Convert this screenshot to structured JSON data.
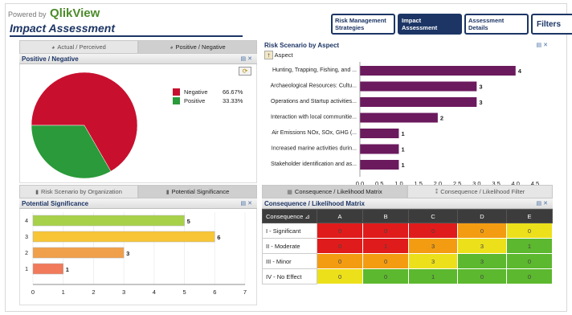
{
  "header": {
    "powered_by": "Powered by",
    "brand": "QlikView",
    "title": "Impact Assessment"
  },
  "nav": {
    "tabs": [
      {
        "label": "Risk Management Strategies"
      },
      {
        "label": "Impact Assessment"
      },
      {
        "label": "Assessment Details"
      }
    ],
    "filters_label": "Filters"
  },
  "colors": {
    "navy": "#1c3565",
    "negative": "#c8102e",
    "positive": "#2a9a3a",
    "bar_purple": "#6b1a5e",
    "cell_red": "#e01b1b",
    "cell_orange": "#f39c12",
    "cell_yellow": "#ece01b",
    "cell_green": "#5cb82e"
  },
  "left_top": {
    "tabs": [
      {
        "label": "Actual / Perceived",
        "icon": "pie-icon"
      },
      {
        "label": "Positive / Negative",
        "icon": "pie-icon"
      }
    ],
    "caption": "Positive / Negative",
    "legend": [
      {
        "label": "Negative",
        "value": "66.67%"
      },
      {
        "label": "Positive",
        "value": "33.33%"
      }
    ]
  },
  "right_top": {
    "caption": "Risk Scenario by Aspect",
    "dim_label": "Aspect"
  },
  "left_bottom": {
    "tabs": [
      {
        "label": "Risk Scenario by Organization"
      },
      {
        "label": "Potential Significance"
      }
    ],
    "caption": "Potential Significance"
  },
  "right_bottom": {
    "tabs": [
      {
        "label": "Consequence / Likelihood Matrix"
      },
      {
        "label": "Consequence / Likelihood Filter"
      }
    ],
    "caption": "Consequence / Likelihood Matrix",
    "header": {
      "label": "Consequence",
      "columns": [
        "A",
        "B",
        "C",
        "D",
        "E"
      ]
    },
    "rows": [
      {
        "label": "I - Significant",
        "values": [
          "0",
          "0",
          "0",
          "0",
          "0"
        ],
        "colors": [
          "red",
          "red",
          "red",
          "orange",
          "yellow"
        ]
      },
      {
        "label": "II - Moderate",
        "values": [
          "0",
          "1",
          "3",
          "3",
          "1"
        ],
        "colors": [
          "red",
          "red",
          "orange",
          "yellow",
          "green"
        ]
      },
      {
        "label": "III - Minor",
        "values": [
          "0",
          "0",
          "3",
          "3",
          "0"
        ],
        "colors": [
          "orange",
          "orange",
          "yellow",
          "green",
          "green"
        ]
      },
      {
        "label": "IV - No Effect",
        "values": [
          "0",
          "0",
          "1",
          "0",
          "0"
        ],
        "colors": [
          "yellow",
          "green",
          "green",
          "green",
          "green"
        ]
      }
    ]
  },
  "chart_data": [
    {
      "type": "pie",
      "title": "Positive / Negative",
      "slices": [
        {
          "label": "Negative",
          "value": 66.67
        },
        {
          "label": "Positive",
          "value": 33.33
        }
      ]
    },
    {
      "type": "bar",
      "orientation": "horizontal",
      "title": "Risk Scenario by Aspect",
      "categories": [
        "Hunting, Trapping, Fishing, and ...",
        "Archaeological Resources: Cultu...",
        "Operations and Startup activities...",
        "Interaction with local communitie...",
        "Air Emissions NOx, SOx, GHG (...",
        "Increased marine activities durin...",
        "Stakeholder identification and as..."
      ],
      "values": [
        4,
        3,
        3,
        2,
        1,
        1,
        1
      ],
      "xticks": [
        "0.0",
        "0.5",
        "1.0",
        "1.5",
        "2.0",
        "2.5",
        "3.0",
        "3.5",
        "4.0",
        "4.5"
      ],
      "xlim": [
        0,
        4.5
      ]
    },
    {
      "type": "bar",
      "orientation": "horizontal",
      "title": "Potential Significance",
      "categories": [
        "4",
        "3",
        "2",
        "1"
      ],
      "values": [
        5,
        6,
        3,
        1
      ],
      "bar_colors": [
        "#a8d14a",
        "#f7c535",
        "#f0a04a",
        "#f07a5a"
      ],
      "xticks": [
        "0",
        "1",
        "2",
        "3",
        "4",
        "5",
        "6",
        "7"
      ],
      "xlim": [
        0,
        7
      ]
    }
  ]
}
